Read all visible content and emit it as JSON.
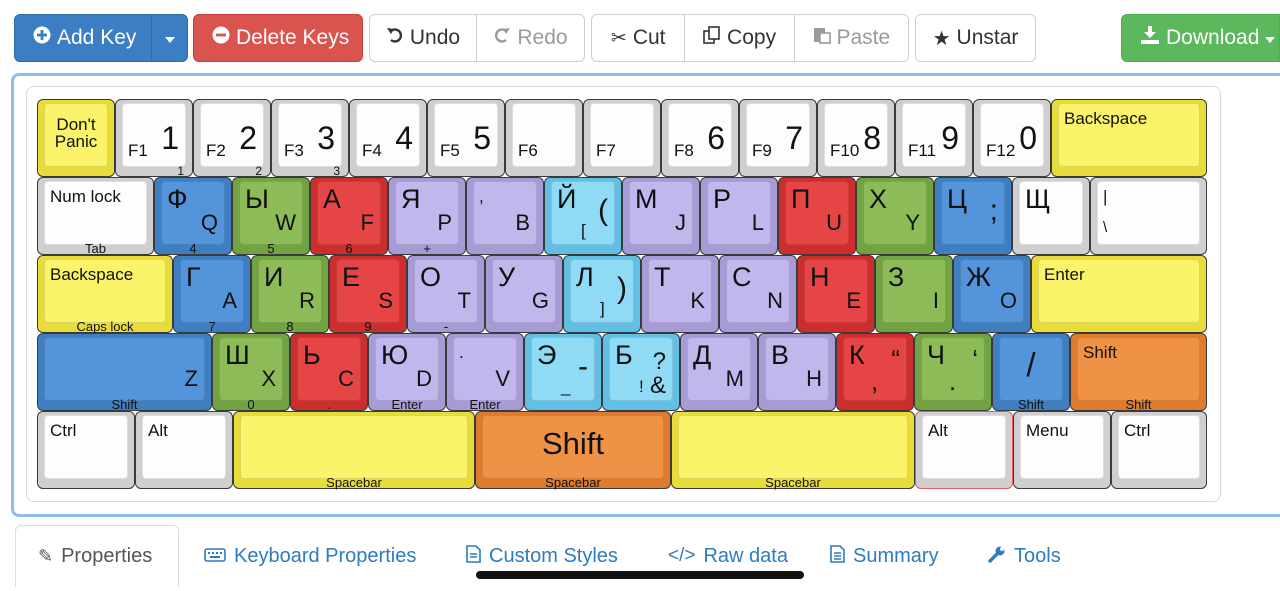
{
  "toolbar": {
    "add_key": "Add Key",
    "delete_keys": "Delete Keys",
    "undo": "Undo",
    "redo": "Redo",
    "cut": "Cut",
    "copy": "Copy",
    "paste": "Paste",
    "unstar": "Unstar",
    "download": "Download"
  },
  "keyboard": {
    "row1": [
      {
        "top": "Don't",
        "bottom": "Panic",
        "color": "yel"
      },
      {
        "front": "1",
        "fn": "F1",
        "num": "1"
      },
      {
        "front": "2",
        "fn": "F2",
        "num": "2"
      },
      {
        "front": "3",
        "fn": "F3",
        "num": "3"
      },
      {
        "fn": "F4",
        "num": "4"
      },
      {
        "fn": "F5",
        "num": "5"
      },
      {
        "fn": "F6"
      },
      {
        "fn": "F7"
      },
      {
        "fn": "F8",
        "num": "6"
      },
      {
        "fn": "F9",
        "num": "7"
      },
      {
        "fn": "F10",
        "num": "8"
      },
      {
        "fn": "F11",
        "num": "9"
      },
      {
        "fn": "F12",
        "num": "0"
      },
      {
        "tl": "Backspace",
        "color": "yel"
      }
    ],
    "row2": [
      {
        "tl": "Num lock",
        "front": "Tab",
        "color": "gray"
      },
      {
        "tl": "Ф",
        "br": "Q",
        "front": "4",
        "color": "blue"
      },
      {
        "tl": "Ы",
        "br": "W",
        "front": "5",
        "color": "green"
      },
      {
        "tl": "А",
        "br": "F",
        "front": "6",
        "color": "red"
      },
      {
        "tl": "Я",
        "br": "P",
        "front": "+",
        "color": "purple"
      },
      {
        "tl": ",",
        "br": "B",
        "color": "purple"
      },
      {
        "tl": "Й",
        "br": "(",
        "sub": "[",
        "color": "cyan"
      },
      {
        "tl": "М",
        "br": "J",
        "color": "purple"
      },
      {
        "tl": "Р",
        "br": "L",
        "color": "purple"
      },
      {
        "tl": "П",
        "br": "U",
        "color": "red"
      },
      {
        "tl": "Х",
        "br": "Y",
        "color": "green"
      },
      {
        "tl": "Ц",
        "br": ";",
        "color": "blue"
      },
      {
        "tl": "Щ",
        "color": "gray"
      },
      {
        "tl": "|",
        "bl": "\\",
        "color": "gray"
      }
    ],
    "row3": [
      {
        "tl": "Backspace",
        "front": "Caps lock",
        "color": "yel"
      },
      {
        "tl": "Г",
        "br": "A",
        "front": "7",
        "color": "blue"
      },
      {
        "tl": "И",
        "br": "R",
        "front": "8",
        "color": "green"
      },
      {
        "tl": "Е",
        "br": "S",
        "front": "9",
        "color": "red"
      },
      {
        "tl": "О",
        "br": "T",
        "front": "-",
        "color": "purple"
      },
      {
        "tl": "У",
        "br": "G",
        "color": "purple"
      },
      {
        "tl": "Л",
        "br": ")",
        "sub": "]",
        "color": "cyan"
      },
      {
        "tl": "Т",
        "br": "K",
        "color": "purple"
      },
      {
        "tl": "С",
        "br": "N",
        "color": "purple"
      },
      {
        "tl": "Н",
        "br": "E",
        "color": "red"
      },
      {
        "tl": "З",
        "br": "I",
        "color": "green"
      },
      {
        "tl": "Ж",
        "br": "O",
        "color": "blue"
      },
      {
        "tl": "Enter",
        "color": "yel"
      }
    ],
    "row4": [
      {
        "br": "Z",
        "front": "Shift",
        "color": "blue"
      },
      {
        "tl": "Ш",
        "br": "X",
        "front": "0",
        "color": "green"
      },
      {
        "tl": "Ь",
        "br": "C",
        "front": ".",
        "color": "red"
      },
      {
        "tl": "Ю",
        "br": "D",
        "front": "Enter",
        "color": "purple"
      },
      {
        "tl": ".",
        "br": "V",
        "front": "Enter",
        "color": "purple"
      },
      {
        "tl": "Э",
        "br": "-",
        "sub": "_",
        "color": "cyan"
      },
      {
        "tl": "Б",
        "br": "?",
        "sub": "!",
        "br2": "&",
        "color": "cyan"
      },
      {
        "tl": "Д",
        "br": "M",
        "color": "purple"
      },
      {
        "tl": "В",
        "br": "H",
        "color": "purple"
      },
      {
        "tl": "К",
        "br": "“",
        "sub": ",",
        "color": "red"
      },
      {
        "tl": "Ч",
        "br": "‘",
        "sub": ".",
        "color": "green"
      },
      {
        "mid": "/",
        "front": "Shift",
        "color": "blue"
      },
      {
        "tl": "Shift",
        "front": "Shift",
        "color": "orange"
      }
    ],
    "row5": [
      {
        "tl": "Ctrl",
        "color": "gray"
      },
      {
        "tl": "Alt",
        "color": "gray"
      },
      {
        "front": "Spacebar",
        "color": "yel"
      },
      {
        "big": "Shift",
        "front": "Spacebar",
        "color": "orange"
      },
      {
        "front": "Spacebar",
        "color": "yel"
      },
      {
        "tl": "Alt",
        "color": "gray",
        "selected": true
      },
      {
        "tl": "Menu",
        "color": "gray"
      },
      {
        "tl": "Ctrl",
        "color": "gray"
      }
    ]
  },
  "tabs": [
    {
      "label": "Properties",
      "icon": "edit-icon",
      "active": true
    },
    {
      "label": "Keyboard Properties",
      "icon": "keyboard-icon"
    },
    {
      "label": "Custom Styles",
      "icon": "file-icon"
    },
    {
      "label": "Raw data",
      "icon": "code-icon"
    },
    {
      "label": "Summary",
      "icon": "document-icon"
    },
    {
      "label": "Tools",
      "icon": "wrench-icon"
    }
  ]
}
